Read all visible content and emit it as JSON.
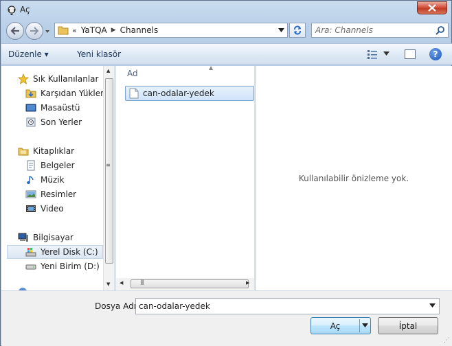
{
  "window": {
    "title": "Aç",
    "colors": {
      "frame": "#b9cfe8",
      "selection": "#cfe3fa",
      "close": "#c13d25"
    }
  },
  "nav": {
    "back_icon": "back-arrow-icon",
    "forward_icon": "forward-arrow-icon"
  },
  "address": {
    "prefix": "«",
    "crumbs": [
      "YaTQA",
      "Channels"
    ]
  },
  "search": {
    "placeholder": "Ara: Channels"
  },
  "toolbar": {
    "organize_label": "Düzenle ▾",
    "new_folder_label": "Yeni klasör",
    "help": "?"
  },
  "sidebar": {
    "groups": [
      {
        "label": "Sık Kullanılanlar",
        "items": [
          "Karşıdan Yüklem",
          "Masaüstü",
          "Son Yerler"
        ]
      },
      {
        "label": "Kitaplıklar",
        "items": [
          "Belgeler",
          "Müzik",
          "Resimler",
          "Video"
        ]
      },
      {
        "label": "Bilgisayar",
        "items": [
          "Yerel Disk (C:)",
          "Yeni Birim (D:)"
        ]
      }
    ],
    "selected": "Yerel Disk (C:)"
  },
  "filelist": {
    "column": "Ad",
    "files": [
      "can-odalar-yedek"
    ]
  },
  "preview": {
    "empty_text": "Kullanılabilir önizleme yok."
  },
  "footer": {
    "filename_label": "Dosya Adı:",
    "filename_value": "can-odalar-yedek",
    "open_label": "Aç",
    "cancel_label": "İptal"
  }
}
